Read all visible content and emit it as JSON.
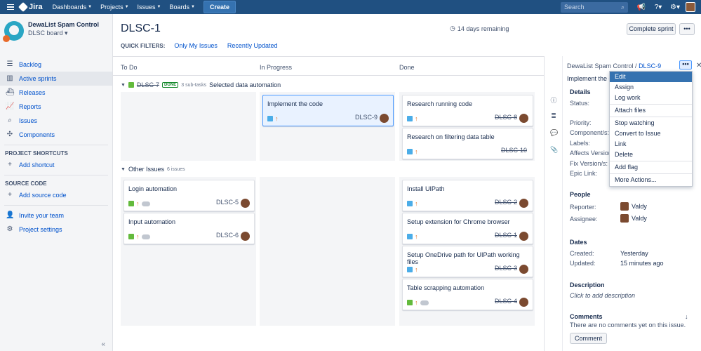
{
  "nav": {
    "brand": "Jira",
    "menus": [
      "Dashboards",
      "Projects",
      "Issues",
      "Boards"
    ],
    "create_label": "Create",
    "search_placeholder": "Search"
  },
  "sidebar": {
    "project_name": "DewaList Spam Control",
    "project_type": "DLSC board",
    "items": [
      {
        "label": "Backlog",
        "icon": "backlog-icon"
      },
      {
        "label": "Active sprints",
        "icon": "board-icon"
      },
      {
        "label": "Releases",
        "icon": "ship-icon"
      },
      {
        "label": "Reports",
        "icon": "chart-icon"
      },
      {
        "label": "Issues",
        "icon": "issues-icon"
      },
      {
        "label": "Components",
        "icon": "puzzle-icon"
      }
    ],
    "shortcuts_heading": "PROJECT SHORTCUTS",
    "add_shortcut": "Add shortcut",
    "source_heading": "SOURCE CODE",
    "add_source": "Add source code",
    "invite": "Invite your team",
    "settings": "Project settings"
  },
  "board": {
    "title": "DLSC-1",
    "quick_filters_label": "QUICK FILTERS:",
    "filters": [
      "Only My Issues",
      "Recently Updated"
    ],
    "days_remaining": "14 days remaining",
    "complete_sprint": "Complete sprint",
    "more": "•••",
    "columns": [
      "To Do",
      "In Progress",
      "Done"
    ],
    "swimlane1": {
      "key": "DLSC-7",
      "status": "DONE",
      "subtasks": "3 sub-tasks",
      "summary": "Selected data automation"
    },
    "swimlane2": {
      "label": "Other Issues",
      "count": "6 issues"
    },
    "cards_lane1_inprogress": [
      {
        "title": "Implement the code",
        "key": "DLSC-9"
      }
    ],
    "cards_lane1_done": [
      {
        "title": "Research running code",
        "key": "DLSC-8"
      },
      {
        "title": "Research on filtering data table",
        "key": "DLSC-10"
      }
    ],
    "cards_lane2_todo": [
      {
        "title": "Login automation",
        "key": "DLSC-5"
      },
      {
        "title": "Input automation",
        "key": "DLSC-6"
      }
    ],
    "cards_lane2_done": [
      {
        "title": "Install UIPath",
        "key": "DLSC-2"
      },
      {
        "title": "Setup extension for Chrome browser",
        "key": "DLSC-1"
      },
      {
        "title": "Setup OneDrive path for UIPath working files",
        "key": "DLSC-3"
      },
      {
        "title": "Table scrapping automation",
        "key": "DLSC-4"
      }
    ]
  },
  "detail": {
    "project_link": "DewaList Spam Control /",
    "issue_key": "DLSC-9",
    "summary": "Implement the co",
    "details_heading": "Details",
    "fields": [
      "Status:",
      "Priority:",
      "Component/s:",
      "Labels:",
      "Affects Version/s:",
      "Fix Version/s:",
      "Epic Link:"
    ],
    "people_heading": "People",
    "reporter_label": "Reporter:",
    "reporter": "Valdy",
    "assignee_label": "Assignee:",
    "assignee": "Valdy",
    "dates_heading": "Dates",
    "created_label": "Created:",
    "created": "Yesterday",
    "updated_label": "Updated:",
    "updated": "15 minutes ago",
    "description_heading": "Description",
    "description_placeholder": "Click to add description",
    "comments_heading": "Comments",
    "no_comments": "There are no comments yet on this issue.",
    "comment_button": "Comment"
  },
  "dropdown": {
    "group1": [
      "Edit",
      "Assign",
      "Log work"
    ],
    "group2": [
      "Attach files"
    ],
    "group3": [
      "Stop watching",
      "Convert to Issue",
      "Link",
      "Delete"
    ],
    "group4": [
      "Add flag"
    ],
    "group5": [
      "More Actions..."
    ]
  }
}
